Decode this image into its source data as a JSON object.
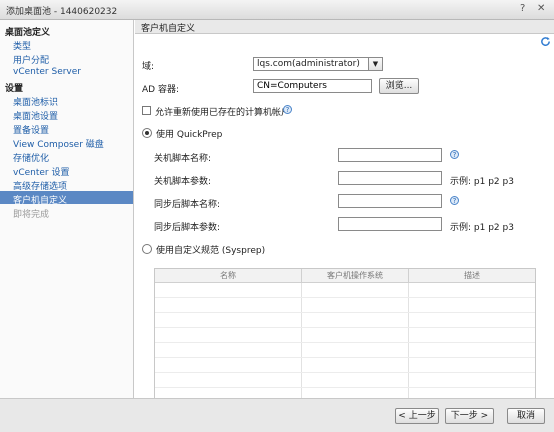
{
  "window": {
    "title": "添加桌面池 - 1440620232"
  },
  "sidebar": {
    "group1": "桌面池定义",
    "group1_items": [
      "类型",
      "用户分配",
      "vCenter Server"
    ],
    "group2": "设置",
    "group2_items": [
      "桌面池标识",
      "桌面池设置",
      "置备设置",
      "View Composer 磁盘",
      "存储优化",
      "vCenter 设置",
      "高级存储选项",
      "客户机自定义",
      "即将完成"
    ],
    "selected": "客户机自定义"
  },
  "content": {
    "header": "客户机自定义",
    "domain_label": "域:",
    "domain_value": "lqs.com(administrator)",
    "ad_label": "AD 容器:",
    "ad_value": "CN=Computers",
    "browse_label": "浏览...",
    "reuse_label": "允许重新使用已存在的计算机帐户",
    "quickprep_label": "使用 QuickPrep",
    "shutdown_script_name": "关机脚本名称:",
    "shutdown_script_params": "关机脚本参数:",
    "postsync_script_name": "同步后脚本名称:",
    "postsync_script_params": "同步后脚本参数:",
    "example_1": "示例: p1 p2 p3",
    "example_2": "示例: p1 p2 p3",
    "sysprep_label": "使用自定义规范 (Sysprep)",
    "table_headers": [
      "名称",
      "客户机操作系统",
      "描述"
    ]
  },
  "footer": {
    "back_label": "< 上一步",
    "next_label": "下一步 >",
    "cancel_label": "取消"
  },
  "colors": {
    "selected_bg": "#5b88c4",
    "link": "#1f5ea8"
  }
}
